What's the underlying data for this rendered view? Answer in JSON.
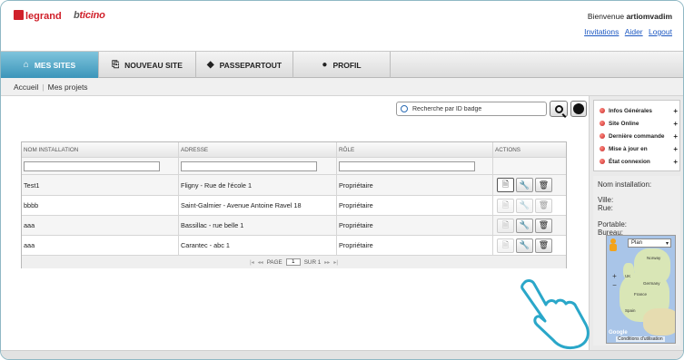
{
  "brand": {
    "legrand": "legrand",
    "bticino": "bticino"
  },
  "user": {
    "welcome_prefix": "Bienvenue",
    "username": "artiomvadim",
    "links": [
      "Invitations",
      "Aider",
      "Logout"
    ]
  },
  "nav": {
    "tabs": [
      {
        "label": "MES SITES",
        "icon": "sites-icon",
        "active": true
      },
      {
        "label": "NOUVEAU SITE",
        "icon": "new-site-icon",
        "active": false
      },
      {
        "label": "PASSEPARTOUT",
        "icon": "tag-icon",
        "active": false
      },
      {
        "label": "PROFIL",
        "icon": "user-icon",
        "active": false
      }
    ]
  },
  "breadcrumb": [
    "Accueil",
    "Mes projets"
  ],
  "search": {
    "placeholder": "Recherche par ID badge"
  },
  "table": {
    "headers": [
      "NOM INSTALLATION",
      "ADRESSE",
      "RÔLE",
      "ACTIONS"
    ],
    "rows": [
      {
        "name": "Test1",
        "address": "Fligny - Rue de l'école 1",
        "role": "Propriétaire"
      },
      {
        "name": "bbbb",
        "address": "Saint-Galmier - Avenue Antoine Ravel 18",
        "role": "Propriétaire"
      },
      {
        "name": "aaa",
        "address": "Bassillac - rue belle 1",
        "role": "Propriétaire"
      },
      {
        "name": "aaa",
        "address": "Carantec - abc 1",
        "role": "Propriétaire"
      }
    ],
    "pager": {
      "page_label": "PAGE",
      "page_value": "1",
      "of_label": "SUR 1"
    }
  },
  "side": {
    "legend": [
      "Infos Générales",
      "Site Online",
      "Dernière commande",
      "Mise à jour en",
      "État connexion"
    ],
    "info": {
      "nom": "Nom installation:",
      "ville": "Ville:",
      "rue": "Rue:",
      "portable": "Portable:",
      "bureau": "Bureau:"
    },
    "map": {
      "type_value": "Plan",
      "labels": [
        "Norway",
        "UK",
        "Germany",
        "France",
        "Spain"
      ],
      "terms": "Conditions d'utilisation",
      "google": "Google"
    }
  },
  "colors": {
    "accent": "#3b95ba",
    "link": "#1d58c2",
    "brand_red": "#d0202a"
  }
}
